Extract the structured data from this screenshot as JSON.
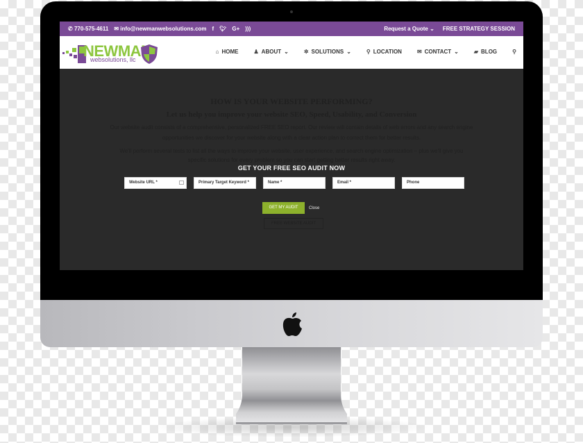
{
  "topbar": {
    "phone": "770-575-4611",
    "email": "info@newmanwebsolutions.com",
    "social": [
      "facebook-icon",
      "twitter-icon",
      "google-plus-icon",
      "rss-icon"
    ],
    "request_quote": "Request a Quote",
    "strategy": "FREE STRATEGY SESSION",
    "color": "#7a4a96"
  },
  "logo": {
    "name": "NEWMAN",
    "sub": "websolutions, llc"
  },
  "nav": {
    "items": [
      {
        "label": "HOME",
        "icon": "home-icon",
        "dropdown": false
      },
      {
        "label": "ABOUT",
        "icon": "user-icon",
        "dropdown": true
      },
      {
        "label": "SOLUTIONS",
        "icon": "gear-icon",
        "dropdown": true
      },
      {
        "label": "LOCATION",
        "icon": "map-pin-icon",
        "dropdown": false
      },
      {
        "label": "CONTACT",
        "icon": "envelope-icon",
        "dropdown": true
      },
      {
        "label": "BLOG",
        "icon": "book-icon",
        "dropdown": false
      }
    ],
    "search_icon": "search-icon"
  },
  "background_content": {
    "heading": "HOW IS YOUR WEBSITE PERFORMING?",
    "subheading": "Let us help you improve your website SEO, Speed, Usability, and Conversion",
    "para1_line1": "Our website audit consists of a comprehensive, personalized FREE SEO report. Our review will contain details of web errors and any search engine",
    "para1_line2": "opportunities we discover for your website along with a clear action plan to correct them for better results.",
    "para2_line1": "We'll perform several tests to list all the ways to improve your website, user experience, and search engine optimization – plus we'll give you",
    "para2_line2": "specific solutions for every problem so you can start getting better results right away.",
    "button": "FREE WEBSITE AUDIT"
  },
  "popup": {
    "title": "GET YOUR FREE SEO AUDIT NOW",
    "fields": [
      {
        "placeholder": "Website URL *",
        "value": ""
      },
      {
        "placeholder": "Primary Target Keyword *",
        "value": ""
      },
      {
        "placeholder": "Name *",
        "value": ""
      },
      {
        "placeholder": "Email *",
        "value": ""
      },
      {
        "placeholder": "Phone",
        "value": ""
      }
    ],
    "submit": "GET MY AUDIT",
    "close": "Close",
    "accent": "#8db12c"
  }
}
